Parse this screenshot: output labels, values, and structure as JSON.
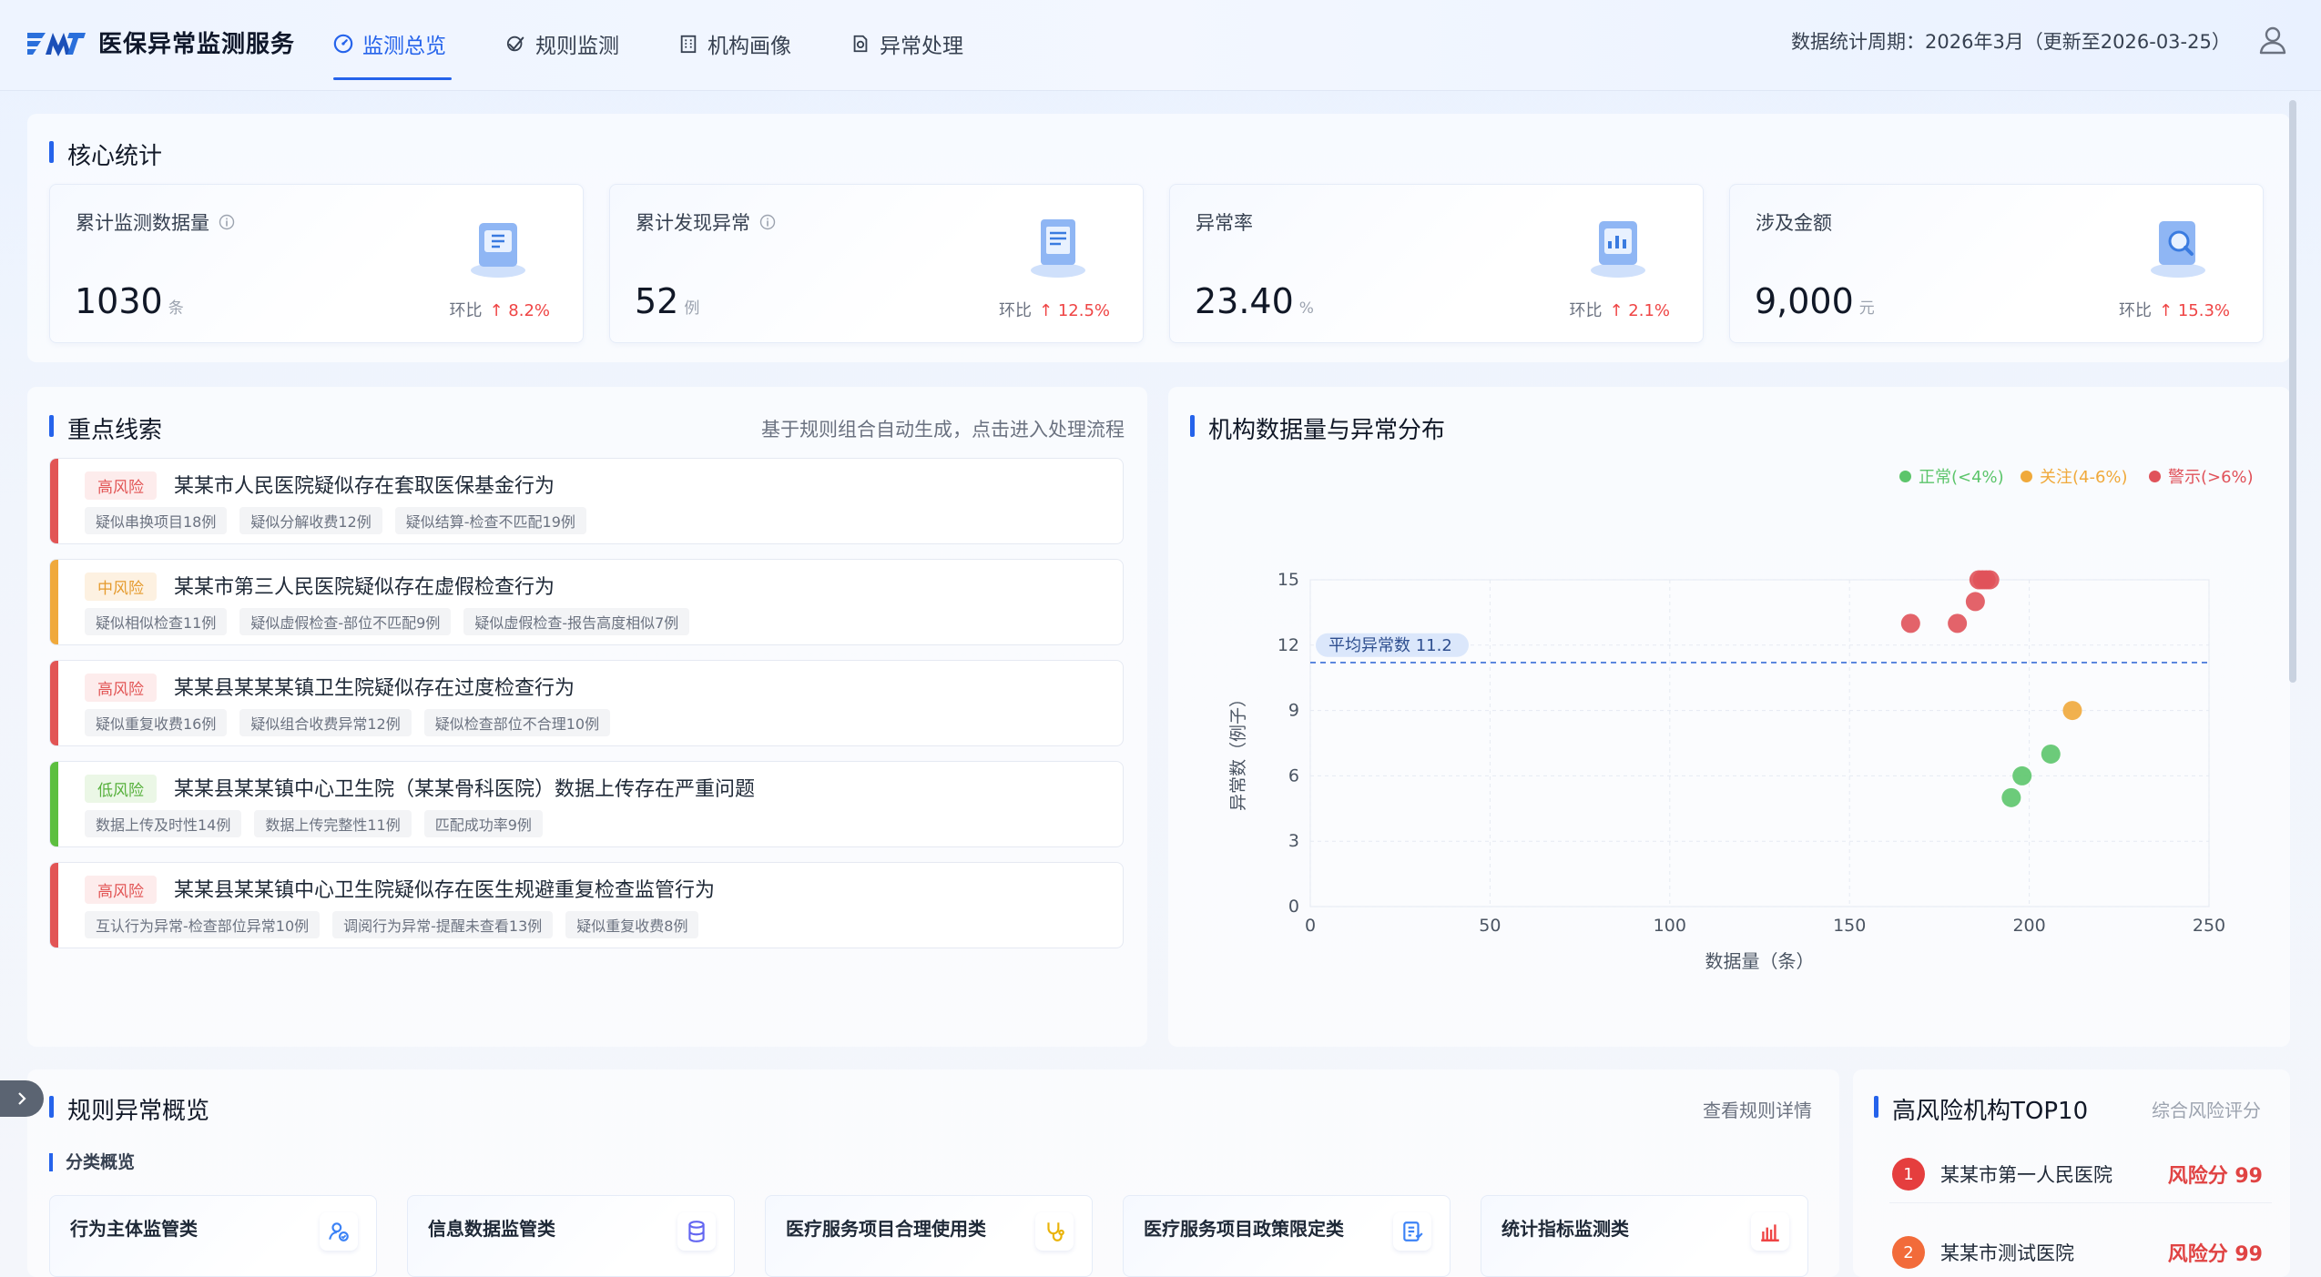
{
  "header": {
    "app_title": "医保异常监测服务",
    "nav": [
      {
        "label": "监测总览",
        "icon": "dashboard-icon",
        "active": true
      },
      {
        "label": "规则监测",
        "icon": "rule-check-icon",
        "active": false
      },
      {
        "label": "机构画像",
        "icon": "building-icon",
        "active": false
      },
      {
        "label": "异常处理",
        "icon": "document-check-icon",
        "active": false
      }
    ],
    "period": "数据统计周期：2026年3月（更新至2026-03-25）"
  },
  "core": {
    "title": "核心统计",
    "cards": [
      {
        "label": "累计监测数据量",
        "value": "1030",
        "unit": "条",
        "change_label": "环比",
        "change": "8.2%",
        "has_info": true
      },
      {
        "label": "累计发现异常",
        "value": "52",
        "unit": "例",
        "change_label": "环比",
        "change": "12.5%",
        "has_info": true
      },
      {
        "label": "异常率",
        "value": "23.40",
        "unit": "%",
        "change_label": "环比",
        "change": "2.1%",
        "has_info": false
      },
      {
        "label": "涉及金额",
        "value": "9,000",
        "unit": "元",
        "change_label": "环比",
        "change": "15.3%",
        "has_info": false
      }
    ]
  },
  "clues": {
    "title": "重点线索",
    "hint": "基于规则组合自动生成，点击进入处理流程",
    "items": [
      {
        "risk": "高风险",
        "level": "high",
        "title": "某某市人民医院疑似存在套取医保基金行为",
        "tags": [
          "疑似串换项目18例",
          "疑似分解收费12例",
          "疑似结算-检查不匹配19例"
        ]
      },
      {
        "risk": "中风险",
        "level": "mid",
        "title": "某某市第三人民医院疑似存在虚假检查行为",
        "tags": [
          "疑似相似检查11例",
          "疑似虚假检查-部位不匹配9例",
          "疑似虚假检查-报告高度相似7例"
        ]
      },
      {
        "risk": "高风险",
        "level": "high",
        "title": "某某县某某某镇卫生院疑似存在过度检查行为",
        "tags": [
          "疑似重复收费16例",
          "疑似组合收费异常12例",
          "疑似检查部位不合理10例"
        ]
      },
      {
        "risk": "低风险",
        "level": "low",
        "title": "某某县某某镇中心卫生院（某某骨科医院）数据上传存在严重问题",
        "tags": [
          "数据上传及时性14例",
          "数据上传完整性11例",
          "匹配成功率9例"
        ]
      },
      {
        "risk": "高风险",
        "level": "high",
        "title": "某某县某某镇中心卫生院疑似存在医生规避重复检查监管行为",
        "tags": [
          "互认行为异常-检查部位异常10例",
          "调阅行为异常-提醒未查看13例",
          "疑似重复收费8例"
        ]
      }
    ]
  },
  "scatter": {
    "title": "机构数据量与异常分布",
    "legend": [
      {
        "label": "正常(<4%)",
        "color": "#5cc56b"
      },
      {
        "label": "关注(4-6%)",
        "color": "#f0a93b"
      },
      {
        "label": "警示(>6%)",
        "color": "#e0525a"
      }
    ],
    "avg_label": "平均异常数 11.2"
  },
  "chart_data": {
    "type": "scatter",
    "title": "机构数据量与异常分布",
    "xlabel": "数据量（条）",
    "ylabel": "异常数（例子）",
    "xlim": [
      0,
      250
    ],
    "ylim": [
      0,
      15
    ],
    "xticks": [
      0,
      50,
      100,
      150,
      200,
      250
    ],
    "yticks": [
      0,
      3,
      6,
      9,
      12,
      15
    ],
    "grid": true,
    "legend_position": "top-right",
    "average_line": 11.2,
    "series": [
      {
        "name": "正常(<4%)",
        "color": "#5cc56b",
        "points": [
          [
            195,
            5
          ],
          [
            198,
            6
          ],
          [
            206,
            7
          ]
        ]
      },
      {
        "name": "关注(4-6%)",
        "color": "#f0a93b",
        "points": [
          [
            212,
            9
          ]
        ]
      },
      {
        "name": "警示(>6%)",
        "color": "#e0525a",
        "points": [
          [
            167,
            13
          ],
          [
            180,
            13
          ],
          [
            185,
            14
          ],
          [
            186,
            15
          ],
          [
            187,
            15
          ],
          [
            188,
            15
          ],
          [
            189,
            15
          ]
        ]
      }
    ]
  },
  "rules": {
    "title": "规则异常概览",
    "link": "查看规则详情",
    "subtitle": "分类概览",
    "categories": [
      {
        "label": "行为主体监管类",
        "icon": "user-check-icon",
        "color": "#3b82f6"
      },
      {
        "label": "信息数据监管类",
        "icon": "database-icon",
        "color": "#6366f1"
      },
      {
        "label": "医疗服务项目合理使用类",
        "icon": "stethoscope-icon",
        "color": "#eab308"
      },
      {
        "label": "医疗服务项目政策限定类",
        "icon": "policy-doc-icon",
        "color": "#3b82f6"
      },
      {
        "label": "统计指标监测类",
        "icon": "bar-chart-icon",
        "color": "#ef4444"
      }
    ]
  },
  "top10": {
    "title": "高风险机构TOP10",
    "subtitle": "综合风险评分",
    "items": [
      {
        "rank": "1",
        "name": "某某市第一人民医院",
        "score": "风险分 99",
        "color": "#e53e3e"
      },
      {
        "rank": "2",
        "name": "某某市测试医院",
        "score": "风险分 99",
        "color": "#f26b3a"
      }
    ]
  }
}
